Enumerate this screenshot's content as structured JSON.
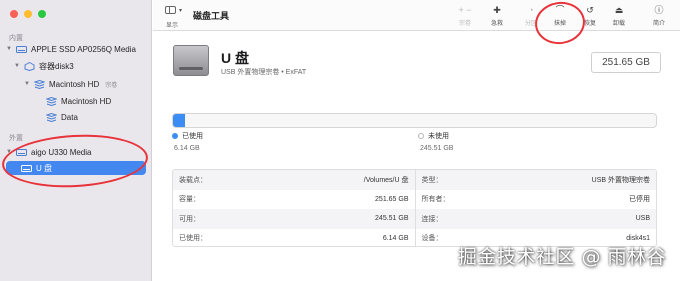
{
  "sidebar": {
    "internal_label": "内置",
    "external_label": "外置",
    "items": [
      {
        "label": "APPLE SSD AP0256Q Media",
        "sub": ""
      },
      {
        "label": "容器disk3",
        "sub": ""
      },
      {
        "label": "Macintosh HD",
        "sub": "宗卷"
      },
      {
        "label": "Macintosh HD",
        "sub": ""
      },
      {
        "label": "Data",
        "sub": ""
      },
      {
        "label": "aigo U330 Media",
        "sub": ""
      },
      {
        "label": "U 盘",
        "sub": ""
      }
    ]
  },
  "toolbar": {
    "show_label": "显示",
    "title": "磁盘工具",
    "tools": [
      {
        "glyph": "+ −",
        "label": "宗卷"
      },
      {
        "glyph": "✚",
        "label": "急救"
      },
      {
        "glyph": "◔",
        "label": "分区"
      },
      {
        "glyph": "⌒",
        "label": "抹掉"
      },
      {
        "glyph": "↺",
        "label": "恢复"
      },
      {
        "glyph": "⏏",
        "label": "卸载"
      },
      {
        "glyph": "ⓘ",
        "label": "简介"
      }
    ]
  },
  "disk": {
    "name": "U 盘",
    "description": "USB 外置物理宗卷 • ExFAT",
    "capacity": "251.65 GB"
  },
  "usage": {
    "used_fraction": 0.024,
    "used_label": "已使用",
    "used_value": "6.14 GB",
    "free_label": "未使用",
    "free_value": "245.51 GB"
  },
  "info": {
    "left": [
      {
        "key": "装载点：",
        "value": "/Volumes/U 盘"
      },
      {
        "key": "容量：",
        "value": "251.65 GB"
      },
      {
        "key": "可用：",
        "value": "245.51 GB"
      },
      {
        "key": "已使用：",
        "value": "6.14 GB"
      }
    ],
    "right": [
      {
        "key": "类型：",
        "value": "USB 外置物理宗卷"
      },
      {
        "key": "所有者：",
        "value": "已停用"
      },
      {
        "key": "连接：",
        "value": "USB"
      },
      {
        "key": "设备：",
        "value": "disk4s1"
      }
    ]
  },
  "watermark": "掘金技术社区 @ 雨林谷",
  "colors": {
    "accent": "#4387f0",
    "used": "#3b8cf3",
    "annotation": "#e8333b"
  }
}
